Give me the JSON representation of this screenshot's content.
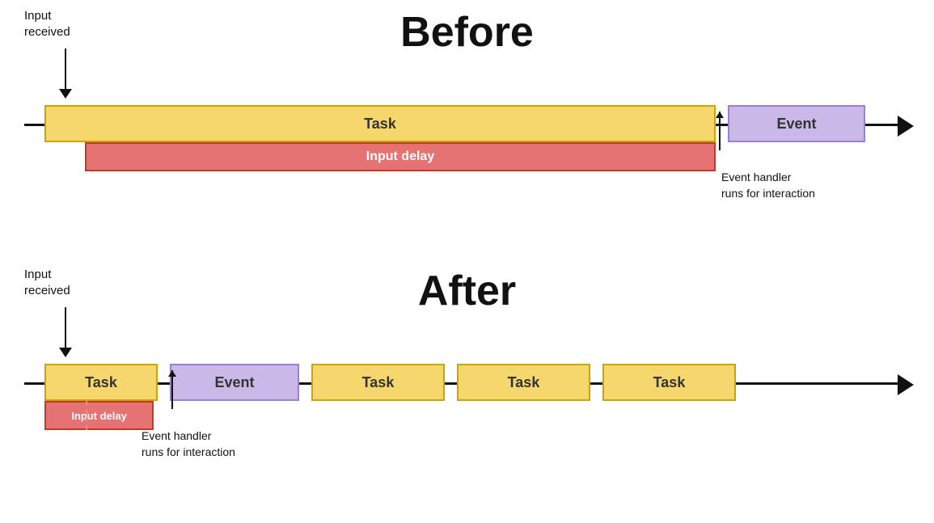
{
  "before": {
    "title": "Before",
    "input_received": "Input\nreceived",
    "task_label": "Task",
    "event_label": "Event",
    "input_delay_label": "Input delay",
    "event_handler_label": "Event handler\nruns for interaction"
  },
  "after": {
    "title": "After",
    "input_received": "Input\nreceived",
    "task_label": "Task",
    "event_label": "Event",
    "task2_label": "Task",
    "task3_label": "Task",
    "task4_label": "Task",
    "input_delay_label": "Input delay",
    "event_handler_label": "Event handler\nruns for interaction"
  }
}
